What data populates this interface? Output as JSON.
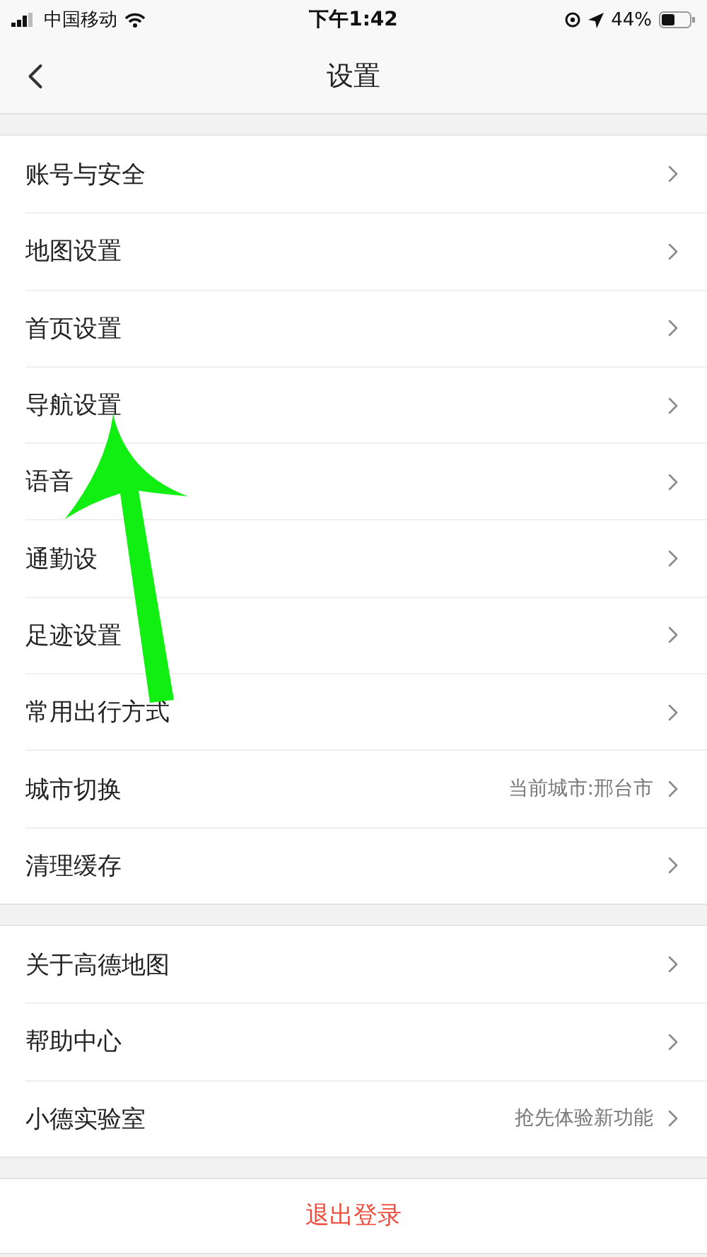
{
  "status_bar": {
    "carrier": "中国移动",
    "time": "下午1:42",
    "battery": "44%"
  },
  "nav": {
    "title": "设置"
  },
  "groups": [
    {
      "items": [
        {
          "label": "账号与安全"
        },
        {
          "label": "地图设置"
        },
        {
          "label": "首页设置"
        },
        {
          "label": "导航设置"
        },
        {
          "label": "语音"
        },
        {
          "label": "通勤设"
        },
        {
          "label": "足迹设置"
        },
        {
          "label": "常用出行方式"
        },
        {
          "label": "城市切换",
          "detail": "当前城市:邢台市"
        },
        {
          "label": "清理缓存"
        }
      ]
    },
    {
      "items": [
        {
          "label": "关于高德地图"
        },
        {
          "label": "帮助中心"
        },
        {
          "label": "小德实验室",
          "detail": "抢先体验新功能"
        }
      ]
    }
  ],
  "logout": "退出登录"
}
